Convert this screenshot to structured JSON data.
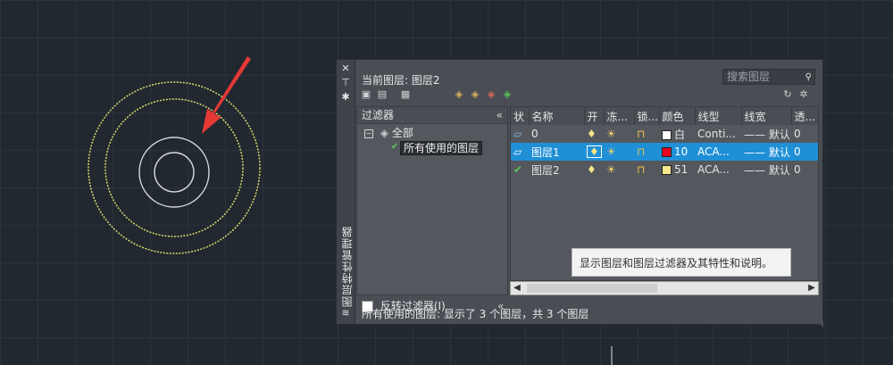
{
  "palette": {
    "current_layer_title": "当前图层: 图层2",
    "search_placeholder": "搜索图层",
    "vertical_title": "图层特性管理器",
    "filter_header": "过滤器",
    "collapse_label": "«",
    "tree_root_label": "全部",
    "tree_child_label": "所有使用的图层",
    "invert_filter_label": "反转过滤器(I)",
    "tooltip": "显示图层和图层过滤器及其特性和说明。",
    "status_text": "所有使用的图层: 显示了 3 个图层，共 3 个图层"
  },
  "table": {
    "columns": [
      "状",
      "名称",
      "开",
      "冻...",
      "锁...",
      "颜色",
      "线型",
      "线宽",
      "透..."
    ],
    "rows": [
      {
        "name": "0",
        "color_label": "白",
        "color_hex": "#ffffff",
        "linetype": "Conti...",
        "lineweight": "—— 默认",
        "transparency": "0",
        "selected": false,
        "status": "layer"
      },
      {
        "name": "图层1",
        "color_label": "10",
        "color_hex": "#e8001c",
        "linetype": "ACA...",
        "lineweight": "—— 默认",
        "transparency": "0",
        "selected": true,
        "status": "layer"
      },
      {
        "name": "图层2",
        "color_label": "51",
        "color_hex": "#f5e88a",
        "linetype": "ACA...",
        "lineweight": "—— 默认",
        "transparency": "0",
        "selected": false,
        "status": "current"
      }
    ]
  },
  "colors": {
    "background": "#212830",
    "circle_yellow": "#d9dc6b",
    "circle_white": "#d8d8d8",
    "arrow_red": "#e53935",
    "selection": "#1f8fd6"
  }
}
